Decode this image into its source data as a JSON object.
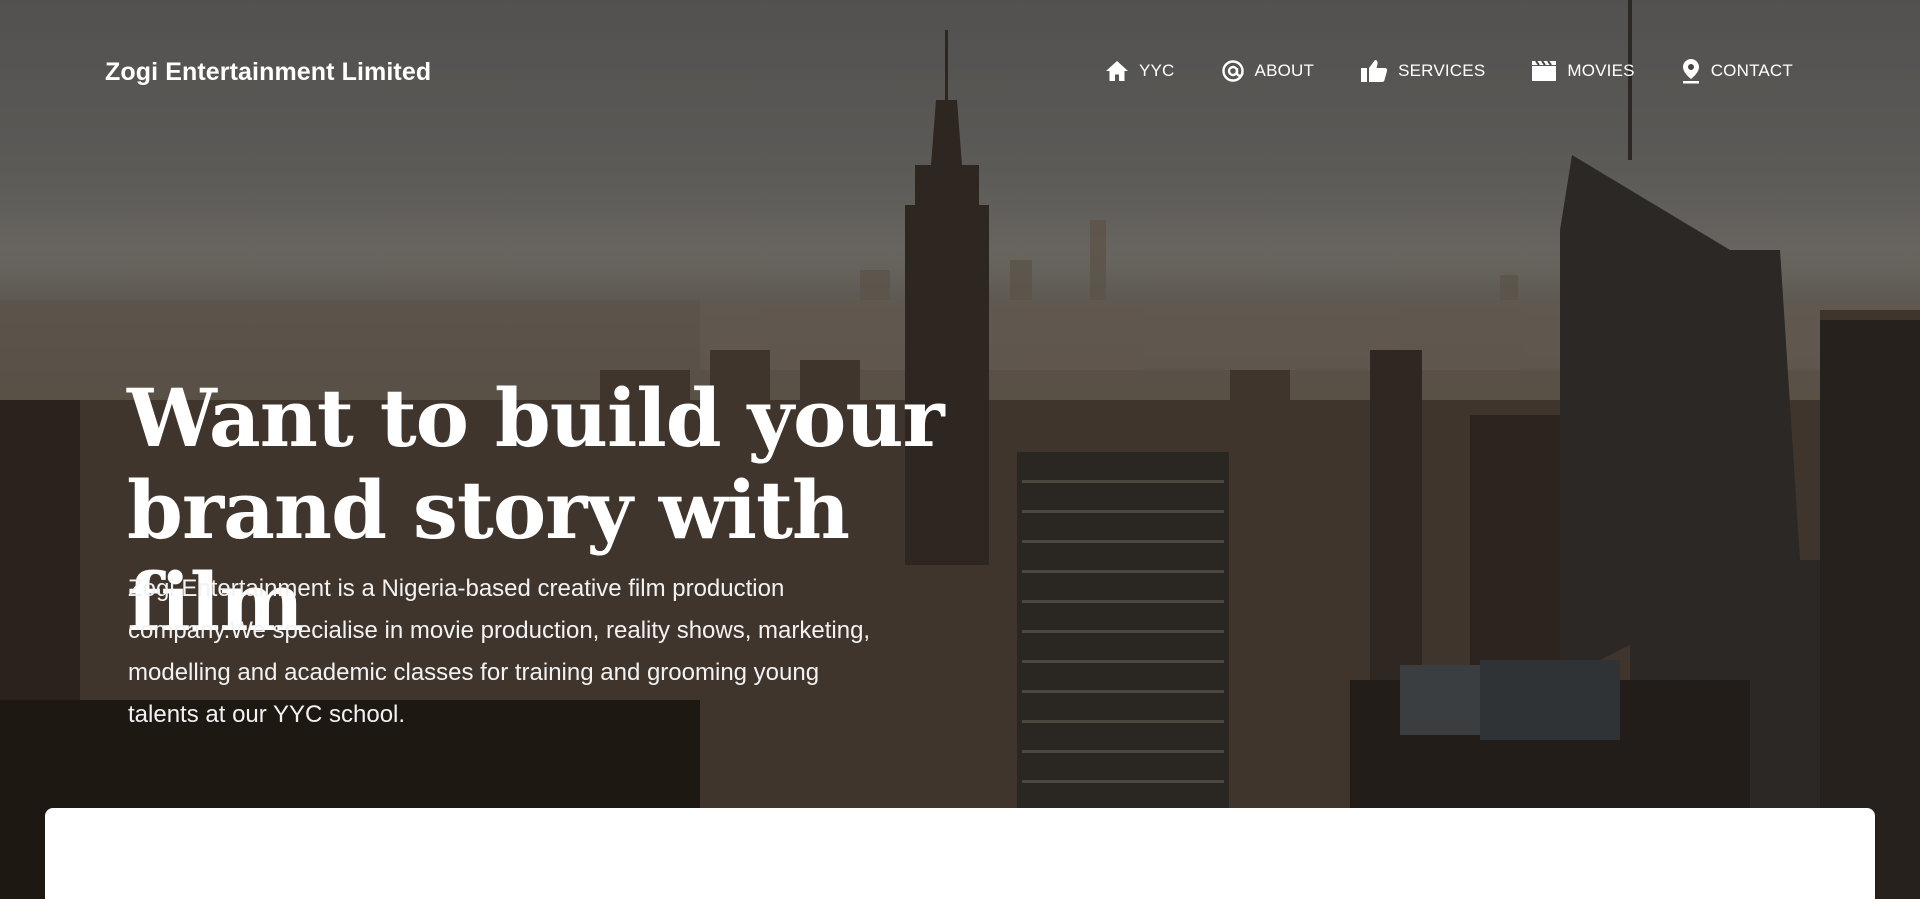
{
  "header": {
    "brand": "Zogi Entertainment Limited"
  },
  "nav": {
    "items": [
      {
        "label": "YYC",
        "icon": "home-icon"
      },
      {
        "label": "ABOUT",
        "icon": "at-icon"
      },
      {
        "label": "SERVICES",
        "icon": "thumbs-up-icon"
      },
      {
        "label": "MOVIES",
        "icon": "clapperboard-icon"
      },
      {
        "label": "CONTACT",
        "icon": "map-pin-icon"
      }
    ]
  },
  "hero": {
    "headline_line1": "Want to build your",
    "headline_line2": "brand story with film",
    "description": "Zogi Entertainment is a Nigeria-based creative film production company.We specialise in movie production, reality shows, marketing, modelling and academic classes for training and grooming young talents at our YYC school."
  },
  "colors": {
    "text": "#ffffff",
    "card": "#ffffff"
  }
}
